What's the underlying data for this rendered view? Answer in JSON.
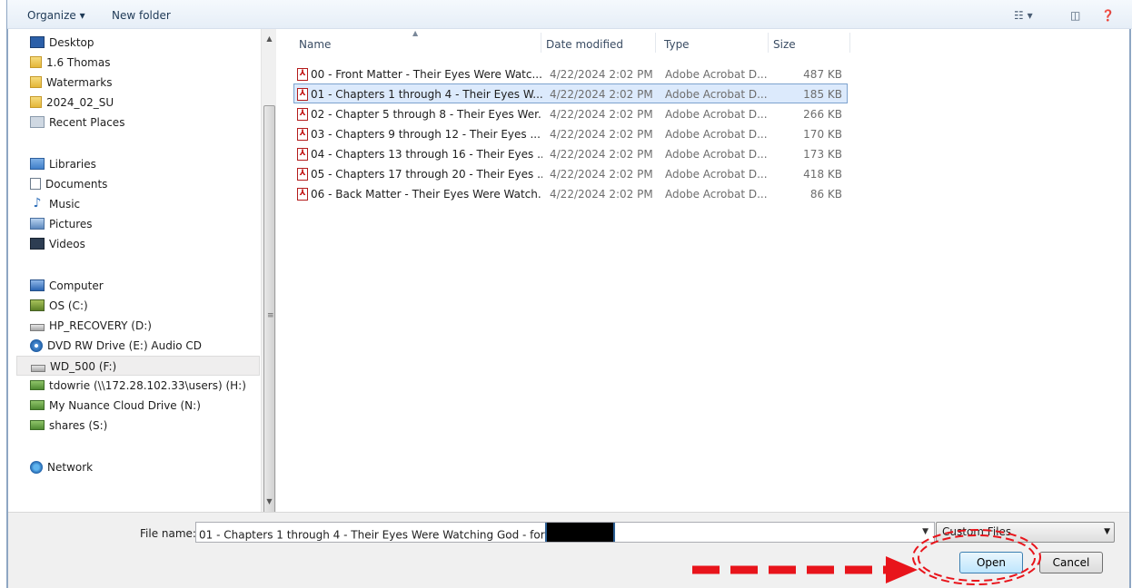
{
  "toolbar": {
    "organize_label": "Organize ▾",
    "new_folder_label": "New folder",
    "view_icon": "view-icon",
    "pane_icon": "preview-pane-icon",
    "help_icon": "help-icon"
  },
  "nav": {
    "items": [
      {
        "label": "Desktop",
        "icon": "desktop-icon"
      },
      {
        "label": "1.6 Thomas",
        "icon": "folder-icon"
      },
      {
        "label": "Watermarks",
        "icon": "folder-icon"
      },
      {
        "label": "2024_02_SU",
        "icon": "folder-icon"
      },
      {
        "label": "Recent Places",
        "icon": "recent-places-icon"
      },
      {
        "label": "Libraries",
        "icon": "libraries-icon"
      },
      {
        "label": "Documents",
        "icon": "documents-icon"
      },
      {
        "label": "Music",
        "icon": "music-icon"
      },
      {
        "label": "Pictures",
        "icon": "pictures-icon"
      },
      {
        "label": "Videos",
        "icon": "videos-icon"
      },
      {
        "label": "Computer",
        "icon": "computer-icon"
      },
      {
        "label": "OS (C:)",
        "icon": "os-drive-icon"
      },
      {
        "label": "HP_RECOVERY (D:)",
        "icon": "drive-icon"
      },
      {
        "label": "DVD RW Drive (E:) Audio CD",
        "icon": "dvd-drive-icon"
      },
      {
        "label": "WD_500 (F:)",
        "icon": "drive-icon"
      },
      {
        "label": "tdowrie (\\\\172.28.102.33\\users) (H:)",
        "icon": "network-drive-icon"
      },
      {
        "label": "My Nuance Cloud Drive (N:)",
        "icon": "network-drive-icon"
      },
      {
        "label": "shares (S:)",
        "icon": "network-drive-icon"
      },
      {
        "label": "Network",
        "icon": "network-icon"
      }
    ],
    "selected": "WD_500 (F:)"
  },
  "columns": {
    "name": "Name",
    "date": "Date modified",
    "type": "Type",
    "size": "Size"
  },
  "files": [
    {
      "name": "00 - Front Matter - Their Eyes Were Watc...",
      "date": "4/22/2024 2:02 PM",
      "type": "Adobe Acrobat D...",
      "size": "487 KB"
    },
    {
      "name": "01 - Chapters 1 through 4 - Their Eyes W...",
      "date": "4/22/2024 2:02 PM",
      "type": "Adobe Acrobat D...",
      "size": "185 KB"
    },
    {
      "name": "02 - Chapter 5 through 8 - Their Eyes Wer...",
      "date": "4/22/2024 2:02 PM",
      "type": "Adobe Acrobat D...",
      "size": "266 KB"
    },
    {
      "name": "03 - Chapters 9 through 12 - Their Eyes ...",
      "date": "4/22/2024 2:02 PM",
      "type": "Adobe Acrobat D...",
      "size": "170 KB"
    },
    {
      "name": "04 - Chapters 13 through 16 - Their Eyes ...",
      "date": "4/22/2024 2:02 PM",
      "type": "Adobe Acrobat D...",
      "size": "173 KB"
    },
    {
      "name": "05 - Chapters 17 through 20 - Their Eyes ...",
      "date": "4/22/2024 2:02 PM",
      "type": "Adobe Acrobat D...",
      "size": "418 KB"
    },
    {
      "name": "06 - Back Matter - Their Eyes Were Watch...",
      "date": "4/22/2024 2:02 PM",
      "type": "Adobe Acrobat D...",
      "size": "86 KB"
    }
  ],
  "selected_file": "01 - Chapters 1 through 4 - Their Eyes W...",
  "bottom": {
    "file_name_label": "File name:",
    "file_name_value": "01 - Chapters 1 through 4 - Their Eyes Were Watching God - for",
    "filter_value": "Custom Files",
    "open_label": "Open",
    "cancel_label": "Cancel"
  },
  "colors": {
    "selection_bg": "#dceafc",
    "annotation_red": "#e8141b"
  }
}
